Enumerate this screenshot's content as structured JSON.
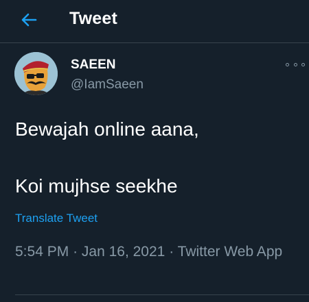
{
  "header": {
    "title": "Tweet",
    "back_icon": "arrow-left-icon",
    "accent": "#1da1f2"
  },
  "tweet": {
    "author": {
      "display_name": "SAEEN",
      "handle": "@IamSaeen"
    },
    "lines": [
      "Bewajah online aana,",
      "Koi mujhse seekhe"
    ],
    "translate_label": "Translate Tweet",
    "time": "5:54 PM",
    "date": "Jan 16, 2021",
    "source": "Twitter Web App",
    "separator": "·",
    "more_icon": "more-options-icon"
  },
  "colors": {
    "background": "#15202b",
    "border": "#38444d",
    "secondary_text": "#8899a6",
    "link": "#1da1f2"
  }
}
